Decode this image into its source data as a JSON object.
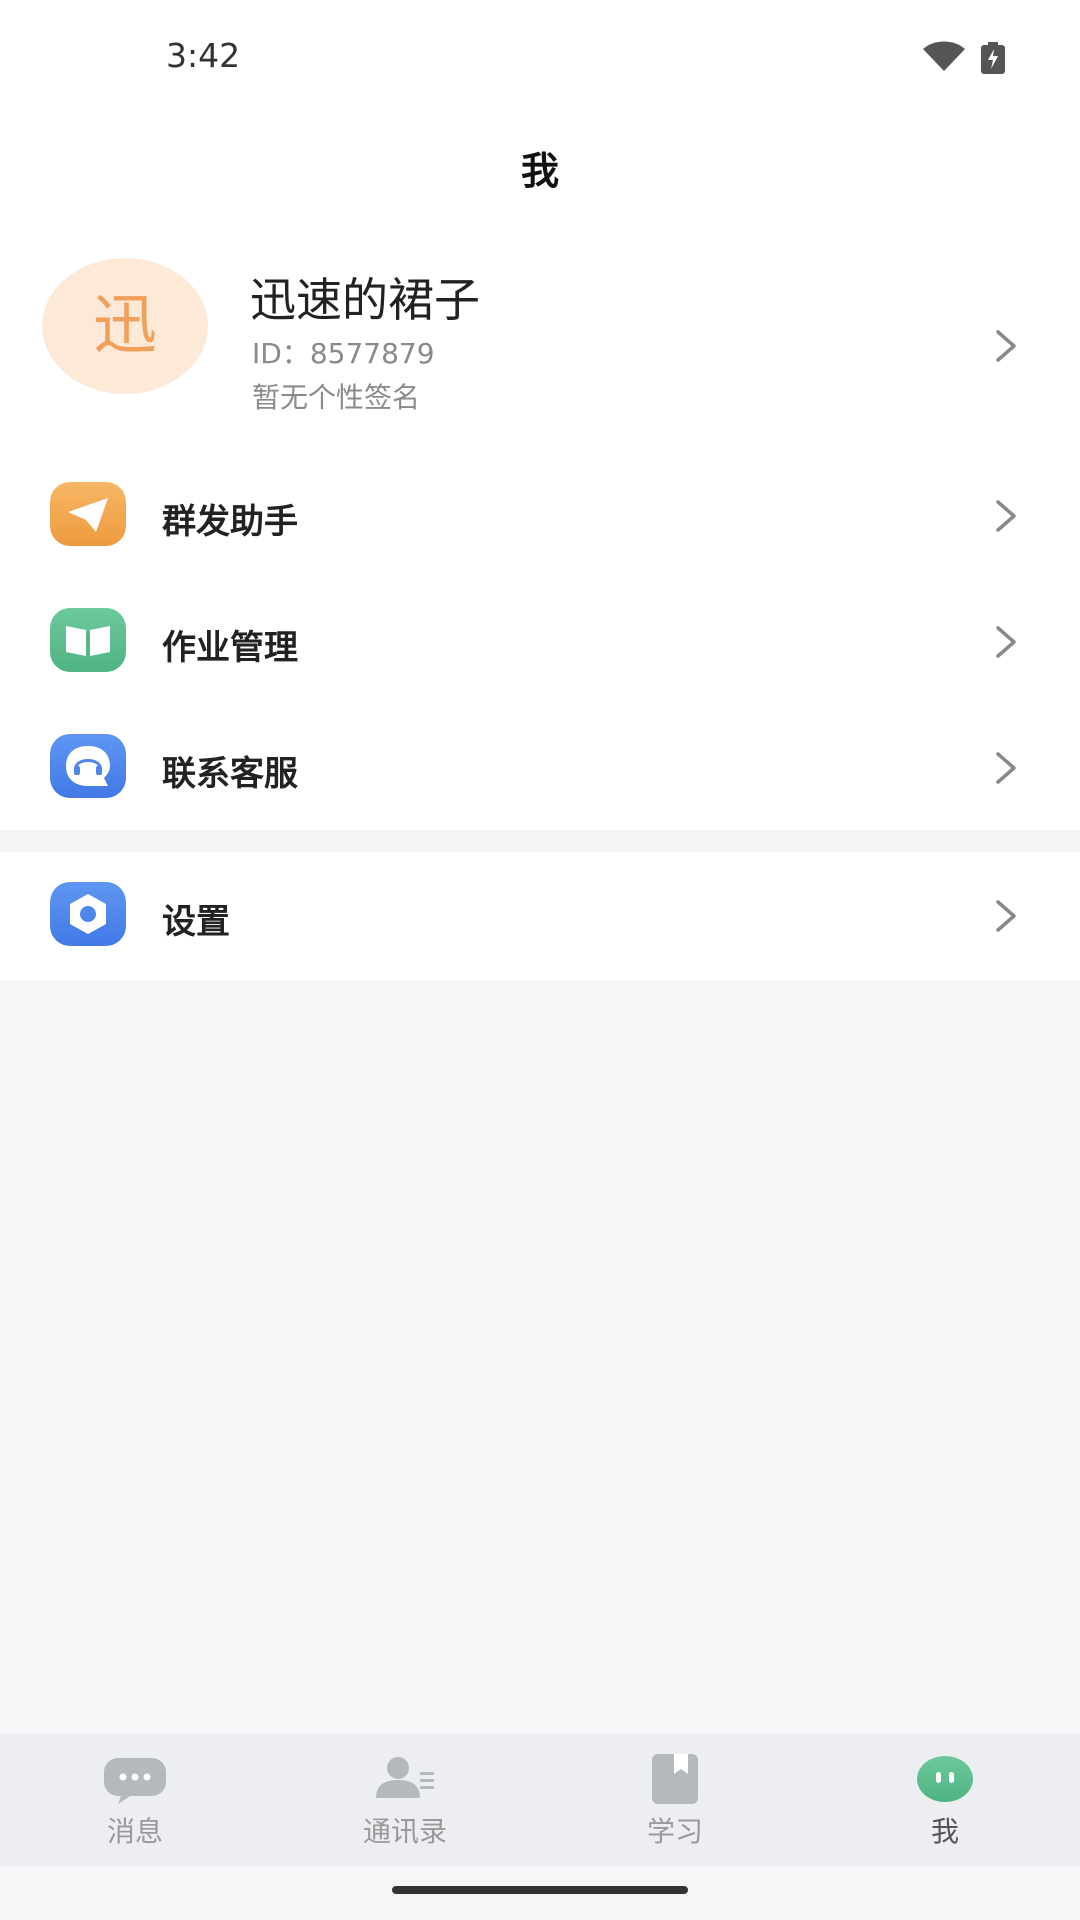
{
  "status_bar": {
    "time": "3:42",
    "wifi_icon": "wifi-icon",
    "battery_icon": "battery-charging-icon"
  },
  "header": {
    "title": "我"
  },
  "profile": {
    "avatar_text": "迅",
    "name": "迅速的裙子",
    "id_text": "ID：8577879",
    "signature": "暂无个性签名"
  },
  "menu": {
    "items": [
      {
        "label": "群发助手",
        "icon": "paper-plane-icon",
        "color": "#f0a048"
      },
      {
        "label": "作业管理",
        "icon": "book-icon",
        "color": "#5cbf8f"
      },
      {
        "label": "联系客服",
        "icon": "headset-chat-icon",
        "color": "#4f86ec"
      }
    ],
    "settings": {
      "label": "设置",
      "icon": "hexagon-gear-icon",
      "color": "#4f86ec"
    }
  },
  "tab_bar": {
    "tabs": [
      {
        "label": "消息",
        "icon": "chat-bubble-icon"
      },
      {
        "label": "通讯录",
        "icon": "contacts-icon"
      },
      {
        "label": "学习",
        "icon": "bookmark-book-icon"
      },
      {
        "label": "我",
        "icon": "me-face-icon",
        "active": true
      }
    ],
    "active_color": "#5cbf8f",
    "inactive_color": "#b5b8bd"
  }
}
